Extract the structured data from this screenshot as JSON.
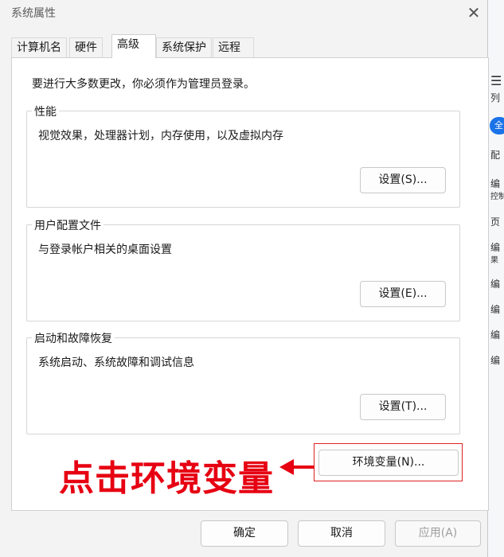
{
  "window": {
    "title": "系统属性",
    "close_label": "✕"
  },
  "tabs": [
    {
      "label": "计算机名"
    },
    {
      "label": "硬件"
    },
    {
      "label": "高级",
      "active": true
    },
    {
      "label": "系统保护"
    },
    {
      "label": "远程"
    }
  ],
  "advanced": {
    "admin_note": "要进行大多数更改，你必须作为管理员登录。",
    "performance": {
      "group_label": "性能",
      "description": "视觉效果，处理器计划，内存使用，以及虚拟内存",
      "button": "设置(S)..."
    },
    "user_profiles": {
      "group_label": "用户配置文件",
      "description": "与登录帐户相关的桌面设置",
      "button": "设置(E)..."
    },
    "startup_recovery": {
      "group_label": "启动和故障恢复",
      "description": "系统启动、系统故障和调试信息",
      "button": "设置(T)..."
    },
    "env_vars_button": "环境变量(N)..."
  },
  "annotation": {
    "text": "点击环境变量",
    "color": "#e60012"
  },
  "footer": {
    "ok": "确定",
    "cancel": "取消",
    "apply": "应用(A)"
  },
  "background_app": {
    "items": [
      "列",
      "全",
      "配",
      "编",
      "控制",
      "页",
      "编",
      "果",
      "编",
      "编",
      "编",
      "编"
    ]
  }
}
